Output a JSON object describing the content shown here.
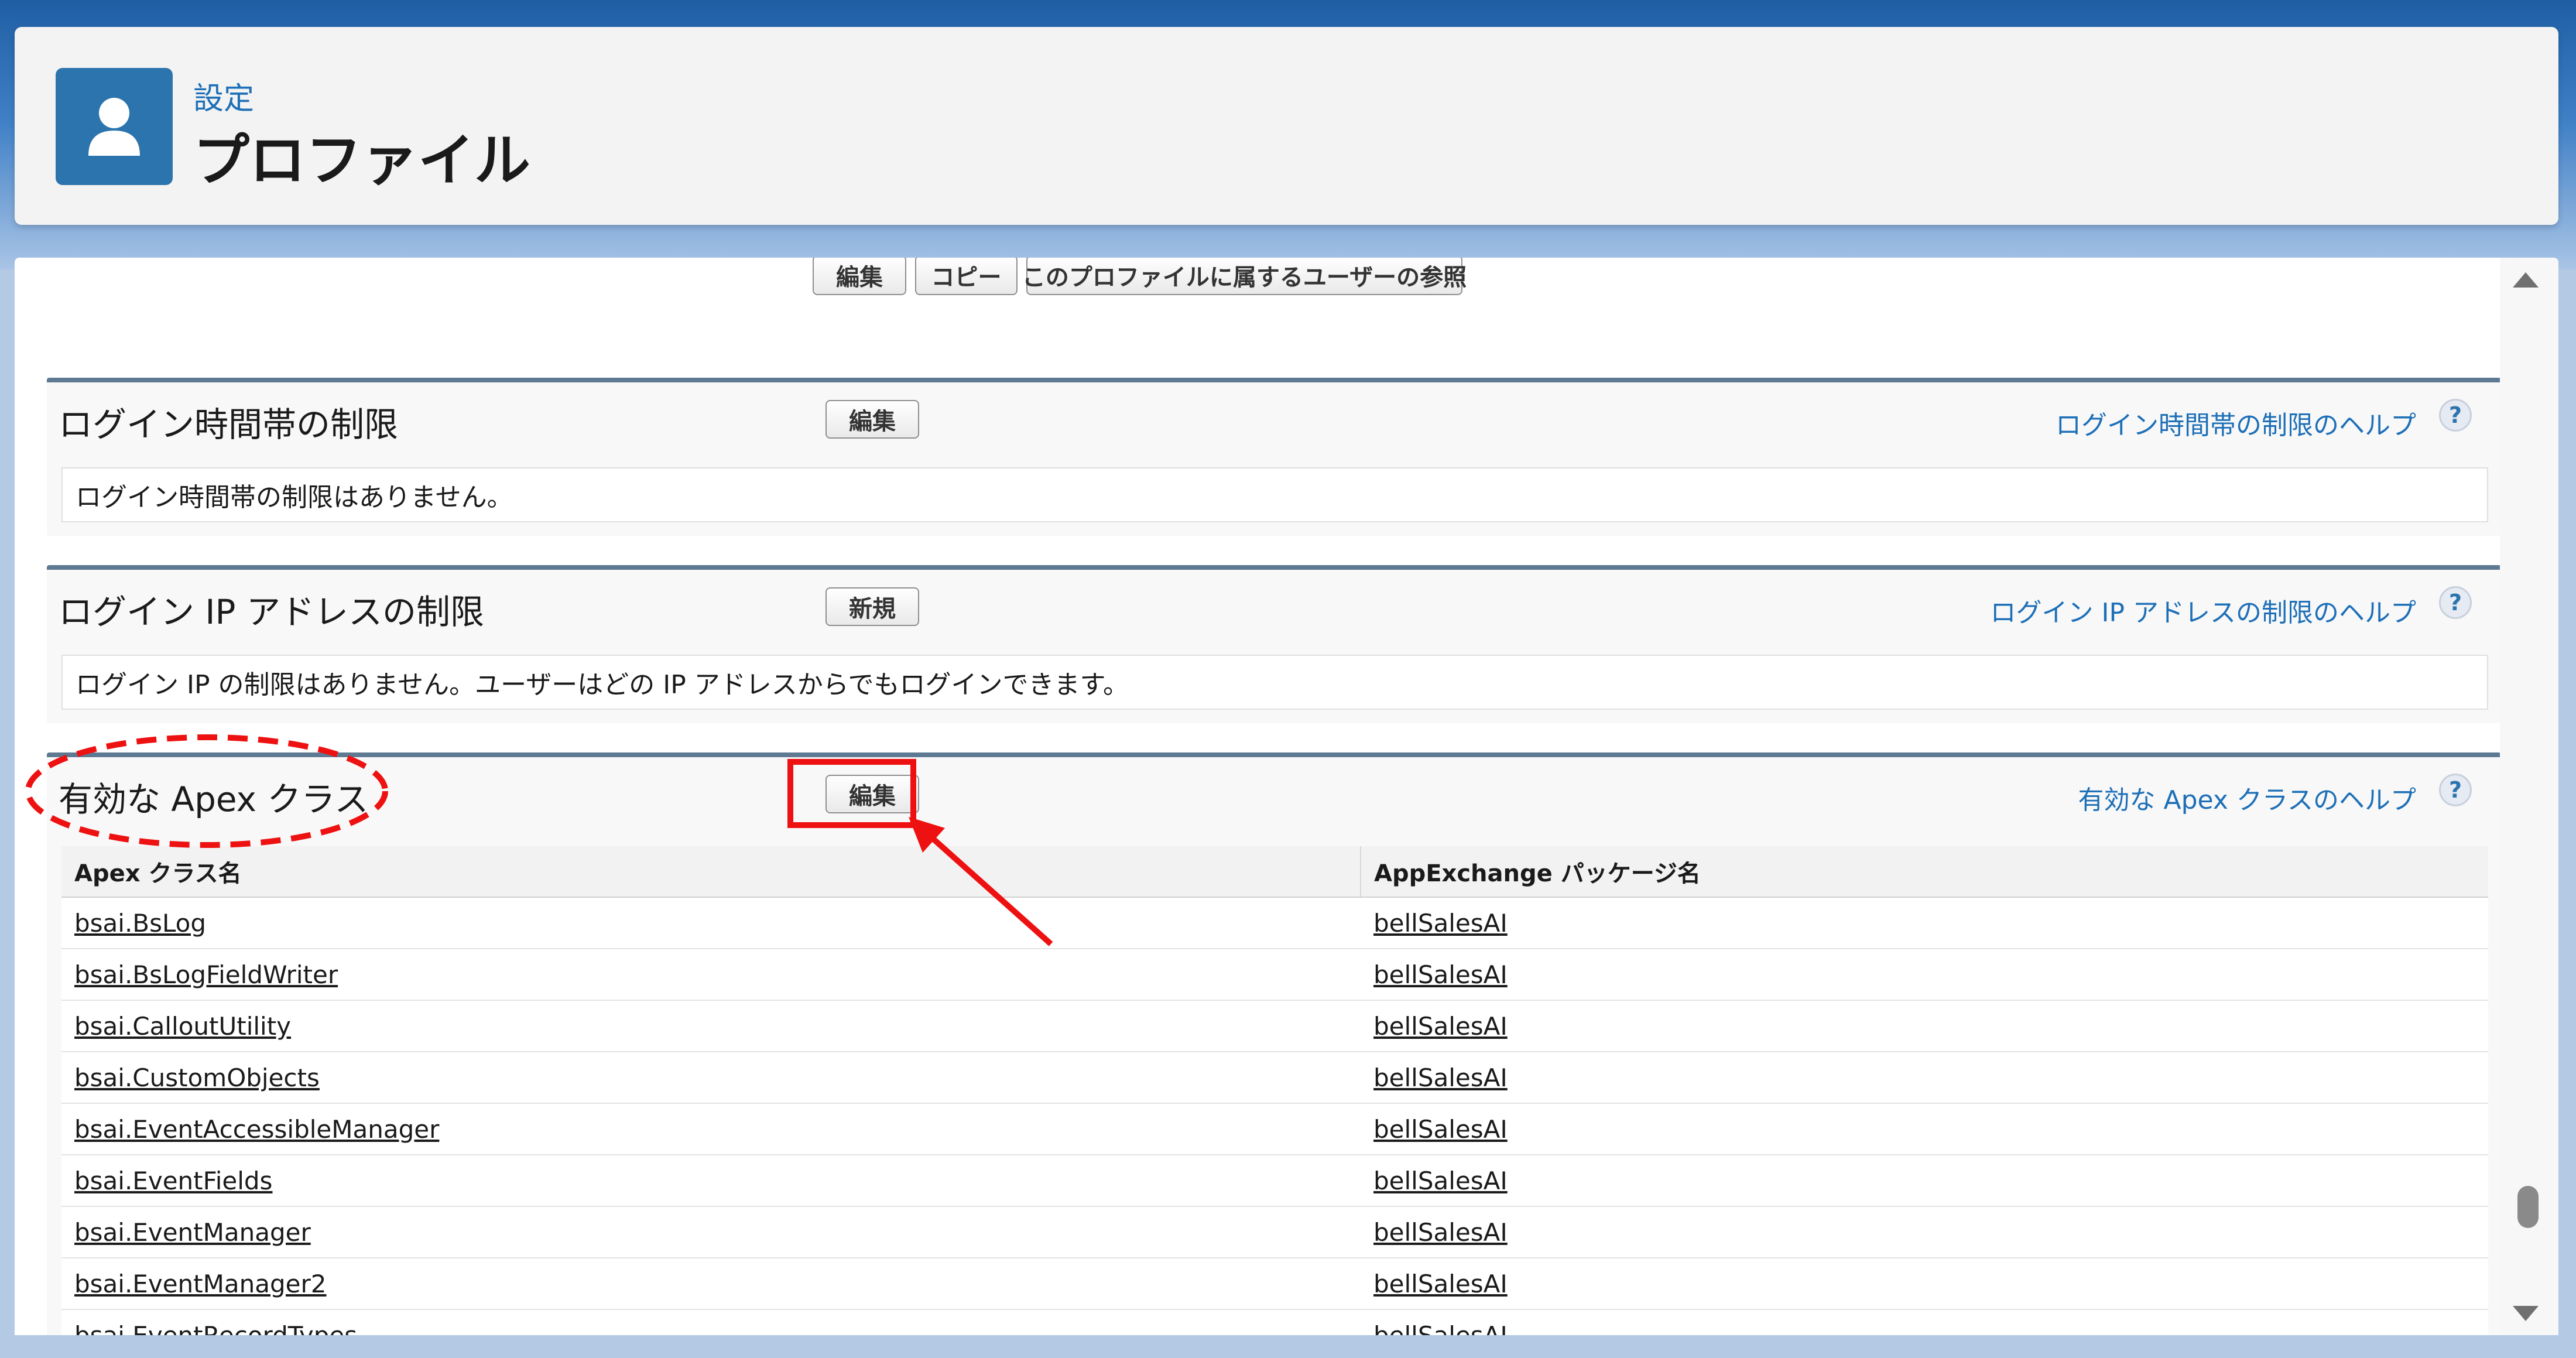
{
  "header": {
    "breadcrumb": "設定",
    "title": "プロファイル",
    "icon": "user-profile-icon"
  },
  "toolbar": {
    "edit_label": "編集",
    "copy_label": "コピー",
    "view_users_label": "このプロファイルに属するユーザーの参照"
  },
  "sections": {
    "login_hours": {
      "title": "ログイン時間帯の制限",
      "button_label": "編集",
      "help_link": "ログイン時間帯の制限のヘルプ",
      "message": "ログイン時間帯の制限はありません。"
    },
    "login_ip": {
      "title": "ログイン IP アドレスの制限",
      "button_label": "新規",
      "help_link": "ログイン IP アドレスの制限のヘルプ",
      "message": "ログイン IP の制限はありません。ユーザーはどの IP アドレスからでもログインできます。"
    },
    "apex_classes": {
      "title": "有効な Apex クラス",
      "button_label": "編集",
      "help_link": "有効な Apex クラスのヘルプ",
      "columns": [
        "Apex クラス名",
        "AppExchange パッケージ名"
      ],
      "rows": [
        [
          "bsai.BsLog",
          "bellSalesAI"
        ],
        [
          "bsai.BsLogFieldWriter",
          "bellSalesAI"
        ],
        [
          "bsai.CalloutUtility",
          "bellSalesAI"
        ],
        [
          "bsai.CustomObjects",
          "bellSalesAI"
        ],
        [
          "bsai.EventAccessibleManager",
          "bellSalesAI"
        ],
        [
          "bsai.EventFields",
          "bellSalesAI"
        ],
        [
          "bsai.EventManager",
          "bellSalesAI"
        ],
        [
          "bsai.EventManager2",
          "bellSalesAI"
        ],
        [
          "bsai.EventRecordTypes",
          "bellSalesAI"
        ]
      ]
    }
  },
  "help_symbol": "?",
  "colors": {
    "accent": "#1d6fb7",
    "header_icon_bg": "#2c74ad",
    "annotation_red": "#ee1111",
    "section_border": "#5e7a93"
  }
}
